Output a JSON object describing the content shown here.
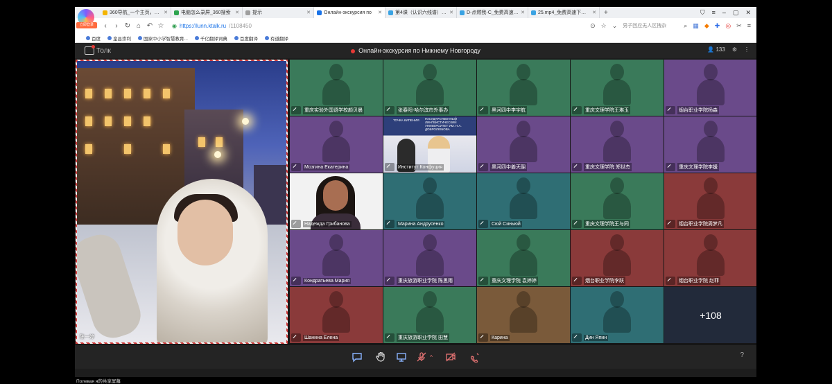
{
  "browser": {
    "tabs": [
      {
        "label": "360导航_一个主页，整个世界",
        "color": "#f4b400",
        "active": false
      },
      {
        "label": "电脑怎么录屏_360搜索",
        "color": "#2ea44f",
        "active": false
      },
      {
        "label": "提示",
        "color": "#9e9e9e",
        "active": false
      },
      {
        "label": "Онлайн-экскурсия по",
        "color": "#1a73e8",
        "active": true
      },
      {
        "label": "第4课（认识六线谱）_海哈",
        "color": "#3aa3e3",
        "active": false
      },
      {
        "label": "D-点燃我-C_免费高速下载|百度",
        "color": "#3aa3e3",
        "active": false
      },
      {
        "label": "25.mp4_免费高速下载|百度",
        "color": "#3aa3e3",
        "active": false
      }
    ],
    "logo_badge": "立即登录",
    "url_domain": "https://lunn.ktalk.ru",
    "url_path": "/1108450",
    "search_placeholder": "男子回应无人区拽杂",
    "bookmarks": [
      "百度",
      "皇县崇利",
      "国家中小学智慧教育...",
      "千亿翻译词典",
      "百度翻译",
      "有道翻译"
    ]
  },
  "app": {
    "brand": "Толк",
    "title": "Онлайн-экскурсия по Нижнему Новгороду",
    "participants_count": "133"
  },
  "main_video": {
    "name": "陈一婷"
  },
  "tiles": [
    {
      "name": "重庆实验外国语学校颜贝晨",
      "color": "#3a7a5a",
      "kind": "avatar"
    },
    {
      "name": "张春阳-哈尔滨市外事办",
      "color": "#3a7a5a",
      "kind": "avatar"
    },
    {
      "name": "黑河四中李宇航",
      "color": "#3a7a5a",
      "kind": "avatar"
    },
    {
      "name": "重庆文理学院王琳玉",
      "color": "#3a7a5a",
      "kind": "avatar"
    },
    {
      "name": "烟台职业学院杨森",
      "color": "#6a4a8a",
      "kind": "avatar"
    },
    {
      "name": "Мозгина Екатерина",
      "color": "#6a4a8a",
      "kind": "avatar"
    },
    {
      "name": "Институт Конфуция",
      "color": "#2d3f7a",
      "kind": "studio"
    },
    {
      "name": "黑河四中姜天翮",
      "color": "#6a4a8a",
      "kind": "avatar"
    },
    {
      "name": "重庆文理学院 郑世杰",
      "color": "#6a4a8a",
      "kind": "avatar"
    },
    {
      "name": "重庆文理学院李媛",
      "color": "#6a4a8a",
      "kind": "avatar"
    },
    {
      "name": "Надежда Грибанова",
      "color": "#f2f2f2",
      "kind": "woman"
    },
    {
      "name": "Марина Андрусенко",
      "color": "#2f6e74",
      "kind": "avatar"
    },
    {
      "name": "Сюй Синьюй",
      "color": "#2f6e74",
      "kind": "avatar"
    },
    {
      "name": "重庆文理学院王与同",
      "color": "#3a7a5a",
      "kind": "avatar"
    },
    {
      "name": "烟台职业学院周梦凡",
      "color": "#8a3a3a",
      "kind": "avatar"
    },
    {
      "name": "Кондратьева Мария",
      "color": "#6a4a8a",
      "kind": "avatar"
    },
    {
      "name": "重庆旅游职业学院 陈思雨",
      "color": "#6a4a8a",
      "kind": "avatar"
    },
    {
      "name": "重庆文理学院 袁婷婷",
      "color": "#3a7a5a",
      "kind": "avatar"
    },
    {
      "name": "烟台职业学院李跃",
      "color": "#8a3a3a",
      "kind": "avatar"
    },
    {
      "name": "烟台职业学院 赵菲",
      "color": "#8a3a3a",
      "kind": "avatar"
    },
    {
      "name": "Шанина Елена",
      "color": "#8a3a3a",
      "kind": "avatar"
    },
    {
      "name": "重庆旅游职业学院 田慧",
      "color": "#3a7a5a",
      "kind": "avatar"
    },
    {
      "name": "Карина",
      "color": "#7a5a3a",
      "kind": "avatar"
    },
    {
      "name": "Дин Япин",
      "color": "#2f6e74",
      "kind": "avatar"
    },
    {
      "name": "+108",
      "color": "#222a3a",
      "kind": "more"
    }
  ],
  "studio_text": {
    "logo": "ТОЧКА КИПЕНИЯ",
    "uni": "ГОСУДАРСТВЕННЫЙ ЛИНГВИСТИЧЕСКИЙ УНИВЕРСИТЕТ ИМ. Н.А. ДОБРОЛЮБОВА"
  },
  "toolbar": {
    "icons": [
      "chat-icon",
      "raise-hand-icon",
      "screen-share-icon",
      "mic-off-icon",
      "camera-off-icon",
      "hangup-icon"
    ],
    "help": "?"
  },
  "status_text": "Полевая я的共享屏幕"
}
